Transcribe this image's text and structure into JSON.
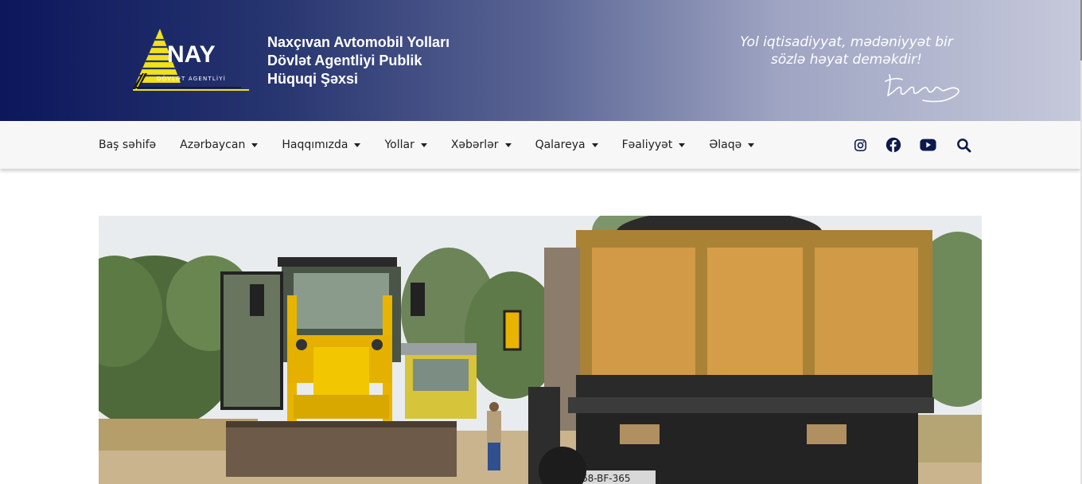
{
  "header": {
    "logo": {
      "text": "NAY",
      "subtext": "DÖVLƏT AGENTLİYİ"
    },
    "agency_name": [
      "Naxçıvan Avtomobil Yolları",
      "Dövlət Agentliyi Publik",
      "Hüquqi Şəxsi"
    ],
    "motto": [
      "Yol iqtisadiyyat, mədəniyyət bir",
      "sözlə həyat deməkdir!"
    ]
  },
  "nav": {
    "items": [
      {
        "label": "Baş səhifə",
        "dropdown": false
      },
      {
        "label": "Azərbaycan",
        "dropdown": true
      },
      {
        "label": "Haqqımızda",
        "dropdown": true
      },
      {
        "label": "Yollar",
        "dropdown": true
      },
      {
        "label": "Xəbərlər",
        "dropdown": true
      },
      {
        "label": "Qalareya",
        "dropdown": true
      },
      {
        "label": "Fəaliyyət",
        "dropdown": true
      },
      {
        "label": "Əlaqə",
        "dropdown": true
      }
    ],
    "icons": [
      "instagram-icon",
      "facebook-icon",
      "youtube-icon",
      "search-icon"
    ]
  },
  "hero": {
    "image": "road-construction-photo",
    "plate_text": "68-BF-365"
  },
  "colors": {
    "header_start": "#0c175c",
    "header_end": "#c6c9db",
    "nav_bg": "#f7f7f7",
    "icon_color": "#0c1a4d",
    "logo_yellow": "#f1e21a"
  }
}
